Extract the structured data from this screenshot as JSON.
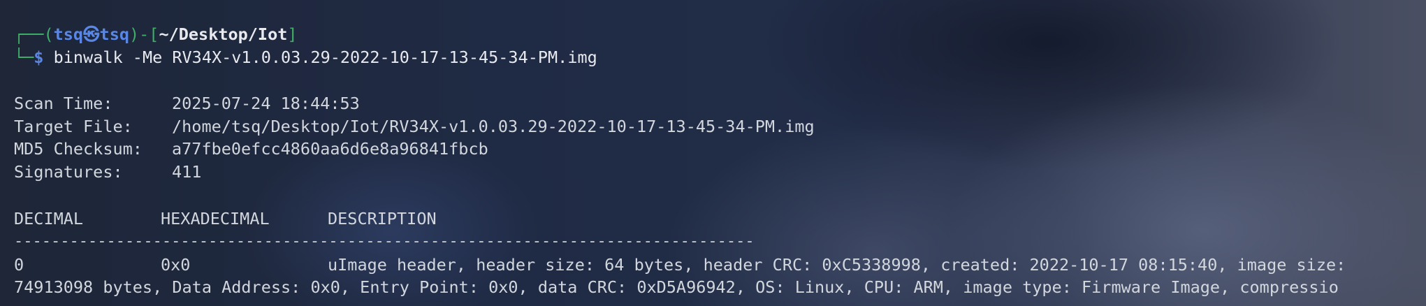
{
  "prompt": {
    "corner_top": "┌──(",
    "user": "tsq",
    "at_symbol": "㉿",
    "host": "tsq",
    "mid": ")-[",
    "path": "~/Desktop/Iot",
    "close": "]",
    "corner_bottom": "└─",
    "dollar": "$",
    "command": "binwalk -Me RV34X-v1.0.03.29-2022-10-17-13-45-34-PM.img"
  },
  "scan_info": {
    "scan_time_label": "Scan Time:",
    "scan_time": "2025-07-24 18:44:53",
    "target_file_label": "Target File:",
    "target_file": "/home/tsq/Desktop/Iot/RV34X-v1.0.03.29-2022-10-17-13-45-34-PM.img",
    "md5_label": "MD5 Checksum:",
    "md5": "a77fbe0efcc4860aa6d6e8a96841fbcb",
    "signatures_label": "Signatures:",
    "signatures": "411"
  },
  "table": {
    "headers": [
      "DECIMAL",
      "HEXADECIMAL",
      "DESCRIPTION"
    ],
    "separator": "--------------------------------------------------------------------------------",
    "rows": [
      {
        "decimal": "0",
        "hex": "0x0",
        "description": "uImage header, header size: 64 bytes, header CRC: 0xC5338998, created: 2022-10-17 08:15:40, image size:"
      }
    ],
    "wrap_line": "74913098 bytes, Data Address: 0x0, Entry Point: 0x0, data CRC: 0xD5A96942, OS: Linux, CPU: ARM, image type: Firmware Image, compressio"
  },
  "colors": {
    "prompt_green": "#3fae68",
    "prompt_blue": "#5a87e6",
    "text": "#d2d6dd"
  }
}
